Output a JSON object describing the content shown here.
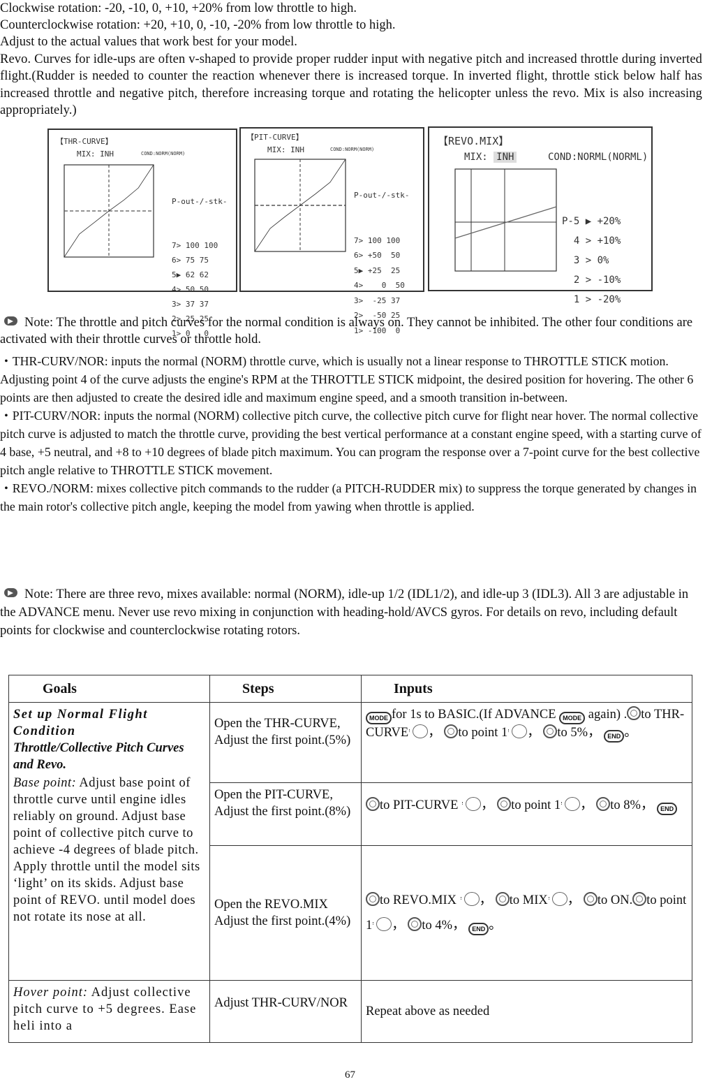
{
  "intro": {
    "line1": "Clockwise rotation: -20, -10, 0, +10, +20% from low throttle to high.",
    "line2": "Counterclockwise rotation: +20, +10, 0, -10, -20% from low throttle to high.",
    "line3": "Adjust to the actual values that work best for your model.",
    "paragraph": "Revo. Curves for idle-ups are often v-shaped to provide proper rudder input with negative pitch and increased throttle during inverted flight.(Rudder is needed to counter the reaction whenever there is increased torque. In inverted flight, throttle stick below half has increased throttle and negative pitch, therefore increasing torque and rotating the helicopter unless the revo. Mix is also increasing appropriately.)"
  },
  "screens": {
    "thr": {
      "title": "【THR-CURVE】",
      "mix": "MIX: INH",
      "cond": "COND:NORM(NORM)",
      "header": "P-out-/-stk-",
      "rows": [
        "7> 100 100",
        "6> 75 75",
        "5▶ 62 62",
        "4> 50 50",
        "3> 37 37",
        "2> 25 25",
        "1> 0   0"
      ],
      "curve": [
        [
          0,
          0
        ],
        [
          17,
          25
        ],
        [
          33,
          37
        ],
        [
          50,
          50
        ],
        [
          67,
          62
        ],
        [
          83,
          75
        ],
        [
          100,
          100
        ]
      ]
    },
    "pit": {
      "title": "【PIT-CURVE】",
      "mix": "MIX: INH",
      "cond": "COND:NORM(NORM)",
      "header": "P-out-/-stk-",
      "rows": [
        "7> 100 100",
        "6> +50  50",
        "5▶ +25  25",
        "4>    0  50",
        "3>  -25 37",
        "2>  -50 25",
        "1> -100  0"
      ],
      "curve": [
        [
          0,
          -100
        ],
        [
          17,
          -50
        ],
        [
          33,
          -25
        ],
        [
          50,
          0
        ],
        [
          67,
          25
        ],
        [
          83,
          50
        ],
        [
          100,
          100
        ]
      ]
    },
    "revo": {
      "title": "【REVO.MIX】",
      "mix_label": "MIX:",
      "mix_value": "INH",
      "cond": "COND:NORML(NORML)",
      "rows": [
        "P-5 ▶ +20%",
        "  4 > +10%",
        "  3 > 0%",
        "  2 > -10%",
        "  1 > -20%"
      ]
    }
  },
  "note1": {
    "text": "Note: The throttle and pitch curves for the normal condition is always on. They cannot be inhibited. The other four conditions are activated with their throttle curves or throttle hold."
  },
  "bullets": [
    {
      "text": "THR-CURV/NOR: inputs the normal (NORM) throttle curve, which is usually not a linear response to THROTTLE STICK motion. Adjusting point 4 of the curve adjusts the engine's RPM at the THROTTLE STICK midpoint, the desired position for hovering. The other 6 points are then adjusted to create the desired idle and maximum engine speed, and a smooth transition in-between."
    },
    {
      "text": "PIT-CURV/NOR: inputs the normal (NORM) collective pitch curve, the collective pitch curve for flight near hover. The normal collective pitch curve is adjusted to match the throttle curve, providing the best vertical performance at a constant engine speed, with a starting curve of 4 base, +5 neutral, and +8 to +10 degrees of blade pitch maximum. You can program the response over a 7-point curve for the best collective pitch angle relative to THROTTLE STICK movement."
    },
    {
      "text": "REVO./NORM: mixes collective pitch commands to the rudder (a PITCH-RUDDER mix) to suppress the torque generated by changes in the main rotor's collective pitch angle, keeping the model from yawing when throttle is applied."
    }
  ],
  "note2": {
    "text": "Note: There are three revo, mixes available: normal (NORM), idle-up 1/2 (IDL1/2), and idle-up 3 (IDL3). All 3 are adjustable in the ADVANCE menu. Never use revo mixing in conjunction with heading-hold/AVCS gyros. For details on revo, including default points for clockwise and counterclockwise rotating rotors."
  },
  "table": {
    "headers": [
      "Goals",
      "Steps",
      "Inputs"
    ],
    "goal1": {
      "title": "Set up Normal Flight Condition",
      "subtitle": "Throttle/Collective Pitch Curves and Revo.",
      "base_label": "Base point:",
      "base_text": " Adjust base point of throttle curve until engine idles reliably on ground. Adjust base point of collective pitch curve to achieve -4 degrees of blade pitch. Apply throttle until the model sits ‘light’ on its skids. Adjust base point of REVO. until model does not rotate its nose at all."
    },
    "goal2": {
      "label": "Hover point:",
      "text": " Adjust collective pitch curve to +5 degrees. Ease heli into a"
    },
    "steps": [
      "Open the THR-CURVE, Adjust the first point.(5%)",
      "Open the PIT-CURVE, Adjust the first point.(8%)",
      "Open the REVO.MIX Adjust the first point.(4%)",
      "Adjust THR-CURV/NOR"
    ],
    "inputs": [
      [
        {
          "i": "mode"
        },
        {
          "t": "for 1s to BASIC.(If ADVANCE "
        },
        {
          "i": "mode"
        },
        {
          "t": " again) ."
        },
        {
          "i": "dial"
        },
        {
          "t": "to THR-CURVE"
        },
        {
          "i": "push"
        },
        {
          "t": "， "
        },
        {
          "i": "dial"
        },
        {
          "t": "to point 1"
        },
        {
          "i": "push"
        },
        {
          "t": "， "
        },
        {
          "i": "dial"
        },
        {
          "t": "to 5%， "
        },
        {
          "i": "end"
        },
        {
          "t": "。"
        }
      ],
      [
        {
          "i": "dial"
        },
        {
          "t": "to PIT-CURVE "
        },
        {
          "i": "push"
        },
        {
          "t": "， "
        },
        {
          "i": "dial"
        },
        {
          "t": "to point 1"
        },
        {
          "i": "push"
        },
        {
          "t": "， "
        },
        {
          "i": "dial"
        },
        {
          "t": "to 8%， "
        },
        {
          "i": "end"
        }
      ],
      [
        {
          "i": "dial"
        },
        {
          "t": "to REVO.MIX "
        },
        {
          "i": "push"
        },
        {
          "t": "， "
        },
        {
          "i": "dial"
        },
        {
          "t": "to MIX"
        },
        {
          "i": "push"
        },
        {
          "t": "， "
        },
        {
          "i": "dial"
        },
        {
          "t": "to ON."
        },
        {
          "i": "dial"
        },
        {
          "t": "to point 1"
        },
        {
          "i": "push"
        },
        {
          "t": "， "
        },
        {
          "i": "dial"
        },
        {
          "t": "to 4%， "
        },
        {
          "i": "end"
        },
        {
          "t": "。"
        }
      ],
      [
        {
          "t": "Repeat above as needed"
        }
      ]
    ],
    "icon_labels": {
      "mode": "MODE",
      "end": "END"
    }
  },
  "page_number": "67"
}
